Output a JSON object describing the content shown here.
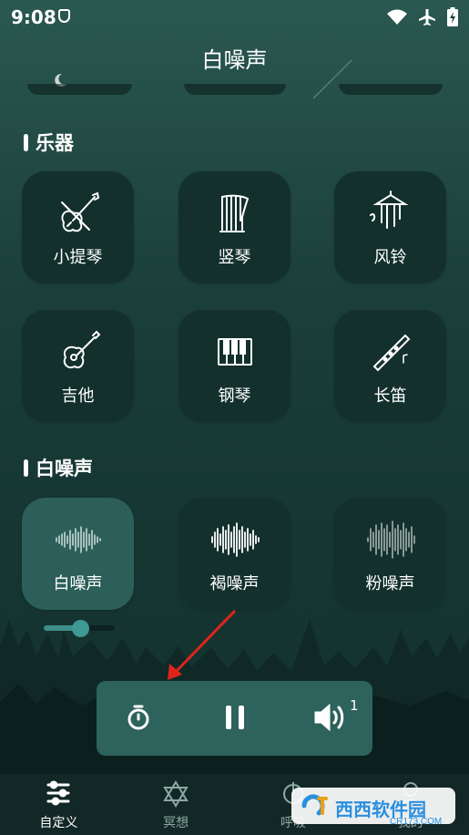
{
  "status_bar": {
    "time": "9:08",
    "icons": [
      "shield-icon",
      "wifi-icon",
      "airplane-icon",
      "battery-charging-icon"
    ]
  },
  "header": {
    "title": "白噪声"
  },
  "sections": {
    "instruments": {
      "title": "乐器",
      "items": [
        {
          "label": "小提琴",
          "icon": "violin-icon"
        },
        {
          "label": "竖琴",
          "icon": "harp-icon"
        },
        {
          "label": "风铃",
          "icon": "wind-chime-icon"
        },
        {
          "label": "吉他",
          "icon": "guitar-icon"
        },
        {
          "label": "钢琴",
          "icon": "piano-icon"
        },
        {
          "label": "长笛",
          "icon": "flute-icon"
        }
      ]
    },
    "noise": {
      "title": "白噪声",
      "items": [
        {
          "label": "白噪声",
          "icon": "white-noise-wave-icon",
          "selected": true
        },
        {
          "label": "褐噪声",
          "icon": "brown-noise-wave-icon",
          "selected": false
        },
        {
          "label": "粉噪声",
          "icon": "pink-noise-wave-icon",
          "selected": false
        }
      ]
    }
  },
  "volume": {
    "level": 0.5
  },
  "player": {
    "sound_count": "1",
    "controls": [
      "timer-icon",
      "pause-icon",
      "volume-icon"
    ]
  },
  "bottom_nav": {
    "items": [
      {
        "label": "自定义",
        "icon": "sliders-icon",
        "active": true
      },
      {
        "label": "冥想",
        "icon": "star-of-david-icon",
        "active": false
      },
      {
        "label": "呼吸",
        "icon": "breath-icon",
        "active": false
      },
      {
        "label": "我的",
        "icon": "profile-icon",
        "active": false
      }
    ]
  },
  "watermark": {
    "text": "西西软件园",
    "sub": "CR173.COM"
  },
  "colors": {
    "card": "#13302c",
    "card_selected": "#2c5f59",
    "player": "#2e625c",
    "accent": "#3f9995",
    "arrow": "#e0241b"
  }
}
